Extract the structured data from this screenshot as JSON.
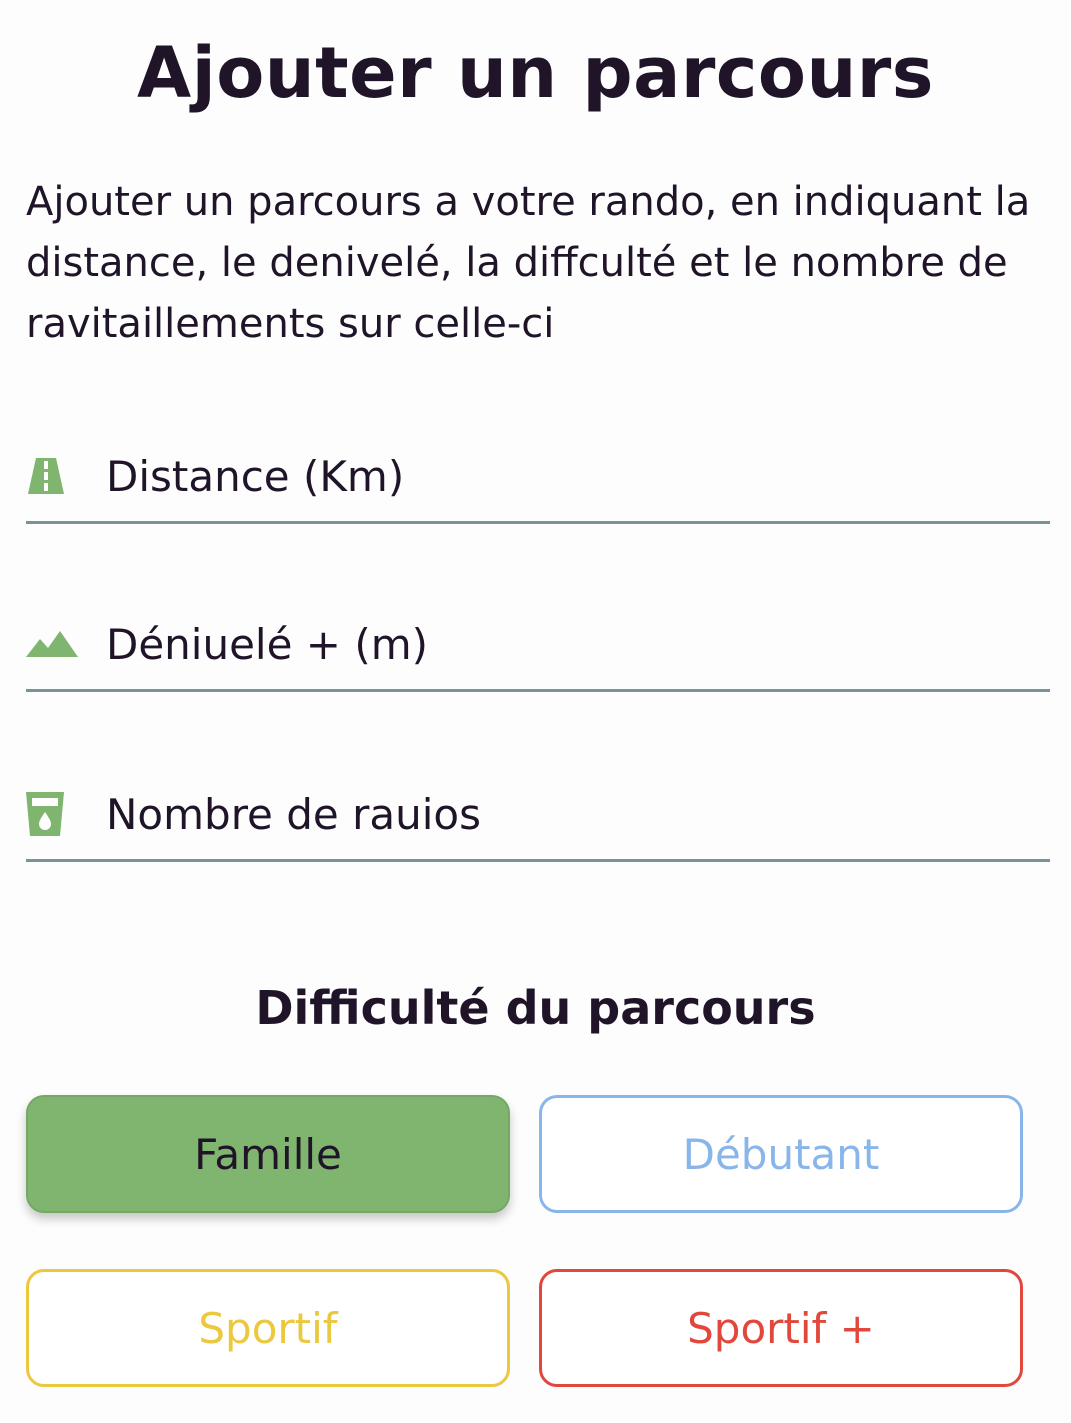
{
  "page": {
    "title": "Ajouter un parcours",
    "description": "Ajouter un parcours a votre rando, en indiquant la distance, le denivelé, la diffculté et le nombre de ravitaillements sur celle-ci"
  },
  "form": {
    "fields": [
      {
        "icon": "road-icon",
        "placeholder": "Distance (Km)",
        "value": ""
      },
      {
        "icon": "mountain-icon",
        "placeholder": "Déniuelé + (m)",
        "value": ""
      },
      {
        "icon": "cup-icon",
        "placeholder": "Nombre de rauios",
        "value": ""
      }
    ]
  },
  "difficulty": {
    "title": "Difficulté du parcours",
    "selected": "Famille",
    "options": [
      {
        "label": "Famille",
        "color": "#7fb56f"
      },
      {
        "label": "Débutant",
        "color": "#88b6ea"
      },
      {
        "label": "Sportif",
        "color": "#ecc83e"
      },
      {
        "label": "Sportif +",
        "color": "#e2473c"
      }
    ]
  },
  "theme": {
    "icon_color": "#7fb56f",
    "text_color": "#1f1428",
    "underline_color": "#7a9298"
  }
}
